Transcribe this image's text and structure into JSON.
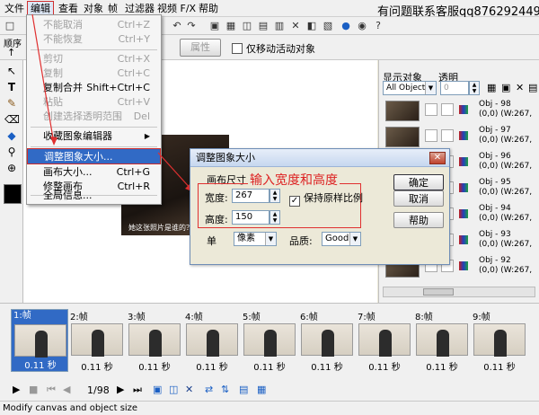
{
  "menubar": {
    "items": [
      "文件",
      "编辑",
      "查看",
      "对象",
      "帧",
      "过滤器",
      "视频 F/X",
      "帮助"
    ]
  },
  "watermark": "有问题联系客服qq876292449",
  "toolbar": {
    "attributes_label": "属性",
    "move_active_only_label": "仅移动活动对象"
  },
  "left_panel": {
    "sequence_label": "顺序"
  },
  "edit_menu": {
    "items": [
      {
        "label": "不能取消",
        "shortcut": "Ctrl+Z",
        "enabled": false
      },
      {
        "label": "不能恢复",
        "shortcut": "Ctrl+Y",
        "enabled": false
      },
      {
        "label": "剪切",
        "shortcut": "Ctrl+X",
        "enabled": false
      },
      {
        "label": "复制",
        "shortcut": "Ctrl+C",
        "enabled": false
      },
      {
        "label": "复制合并",
        "shortcut": "Shift+Ctrl+C",
        "enabled": true
      },
      {
        "label": "粘贴",
        "shortcut": "Ctrl+V",
        "enabled": false
      },
      {
        "label": "创建选择透明范围",
        "shortcut": "Del",
        "enabled": false
      },
      {
        "label": "收藏图象编辑器",
        "shortcut": "",
        "enabled": true
      },
      {
        "label": "调整图象大小...",
        "shortcut": "",
        "enabled": true
      },
      {
        "label": "画布大小...",
        "shortcut": "Ctrl+G",
        "enabled": true
      },
      {
        "label": "修整画布",
        "shortcut": "Ctrl+R",
        "enabled": true
      },
      {
        "label": "全局信息...",
        "shortcut": "",
        "enabled": true
      }
    ]
  },
  "canvas": {
    "subtitle": "她这张照片是谁的？"
  },
  "dialog": {
    "title": "调整图象大小",
    "group_label": "画布尺寸",
    "width_label": "宽度:",
    "width_value": "267",
    "height_label": "高度:",
    "height_value": "150",
    "keep_ratio_label": "保持原样比例",
    "unit_label": "单",
    "unit_value": "像素",
    "quality_label": "品质:",
    "quality_value": "Good",
    "ok_label": "确定",
    "cancel_label": "取消",
    "help_label": "帮助",
    "annotation": "输入宽度和高度"
  },
  "right_panel": {
    "show_objects_label": "显示对象",
    "transparency_label": "透明",
    "filter_value": "All Object",
    "transparency_value": "0",
    "objects": [
      {
        "name": "Obj - 98",
        "pos": "(0,0) ",
        "size": "(W:267,"
      },
      {
        "name": "Obj - 97",
        "pos": "(0,0) ",
        "size": "(W:267,"
      },
      {
        "name": "Obj - 96",
        "pos": "(0,0) ",
        "size": "(W:267,"
      },
      {
        "name": "Obj - 95",
        "pos": "(0,0) ",
        "size": "(W:267,"
      },
      {
        "name": "Obj - 94",
        "pos": "(0,0) ",
        "size": "(W:267,"
      },
      {
        "name": "Obj - 93",
        "pos": "(0,0) ",
        "size": "(W:267,"
      },
      {
        "name": "Obj - 92",
        "pos": "(0,0) ",
        "size": "(W:267,"
      }
    ]
  },
  "timeline": {
    "frames": [
      {
        "label": "1:帧",
        "time": "0.11 秒"
      },
      {
        "label": "2:帧",
        "time": "0.11 秒"
      },
      {
        "label": "3:帧",
        "time": "0.11 秒"
      },
      {
        "label": "4:帧",
        "time": "0.11 秒"
      },
      {
        "label": "5:帧",
        "time": "0.11 秒"
      },
      {
        "label": "6:帧",
        "time": "0.11 秒"
      },
      {
        "label": "7:帧",
        "time": "0.11 秒"
      },
      {
        "label": "8:帧",
        "time": "0.11 秒"
      },
      {
        "label": "9:帧",
        "time": "0.11 秒"
      }
    ]
  },
  "playbar": {
    "frame_counter": "1/98"
  },
  "status": "Modify canvas and object size",
  "colors": {
    "highlight": "#316ac5",
    "annotation_red": "#dd2222",
    "dialog_bg": "#ece9d8"
  }
}
